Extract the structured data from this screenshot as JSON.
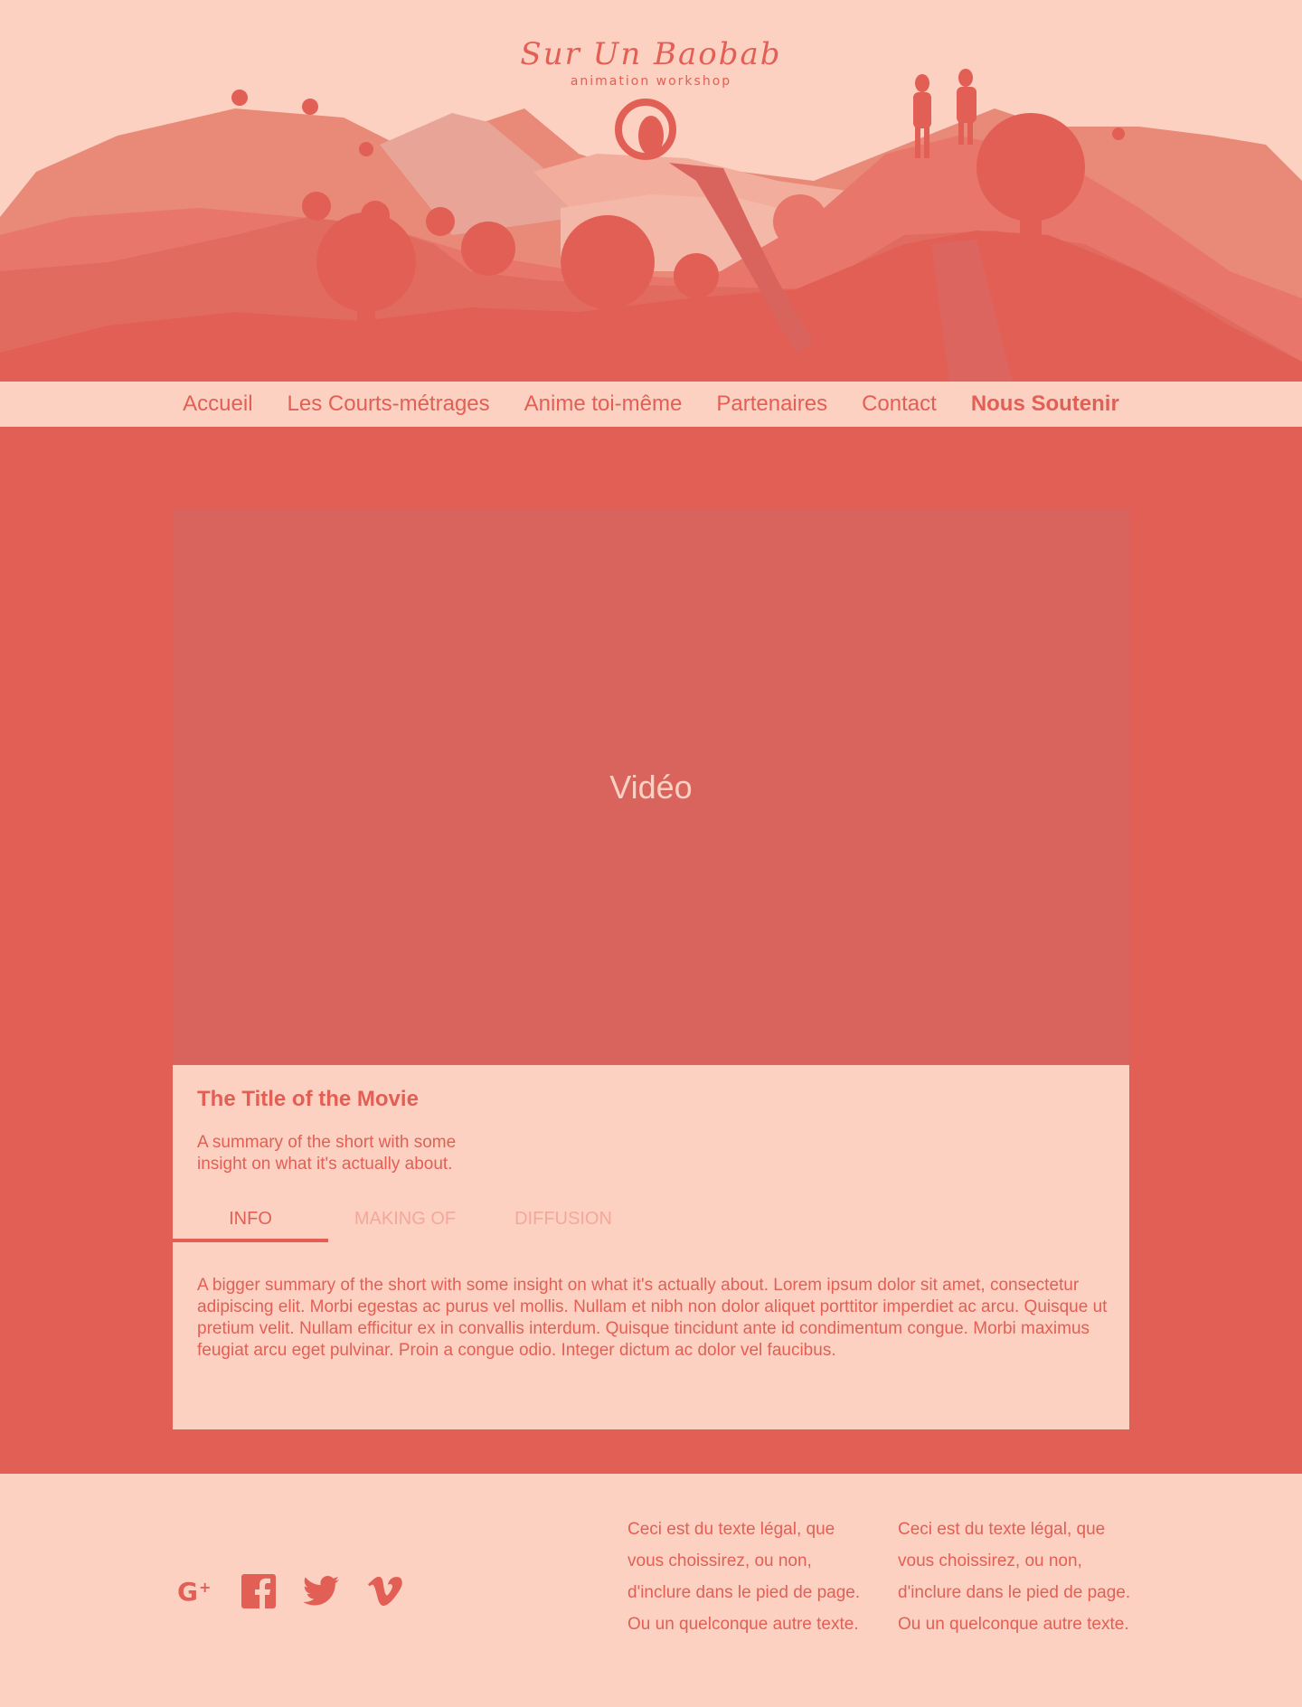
{
  "brand": {
    "title": "Sur Un Baobab",
    "subtitle": "animation workshop"
  },
  "nav": {
    "items": [
      "Accueil",
      "Les Courts-métrages",
      "Anime toi-même",
      "Partenaires",
      "Contact"
    ],
    "cta": "Nous Soutenir"
  },
  "video": {
    "label": "Vidéo"
  },
  "movie": {
    "title": "The Title of the Movie",
    "summary": "A summary of the short with some insight on what it's actually about.",
    "tabs": [
      "INFO",
      "MAKING OF",
      "DIFFUSION"
    ],
    "active_tab": "INFO",
    "long_summary": "A bigger summary of the short with some insight on what it's actually about. Lorem ipsum dolor sit amet, consectetur adipiscing elit. Morbi egestas ac purus vel mollis. Nullam et nibh non dolor aliquet porttitor imperdiet ac arcu. Quisque ut pretium velit. Nullam efficitur ex in convallis interdum. Quisque tincidunt ante id condimentum congue. Morbi maximus feugiat arcu eget pulvinar. Proin a congue odio. Integer dictum ac dolor vel faucibus."
  },
  "footer": {
    "social_icons": [
      "google-plus-icon",
      "facebook-icon",
      "twitter-icon",
      "vimeo-icon"
    ],
    "legal_1": "Ceci est du texte légal, que vous choissirez, ou non, d'inclure dans le pied de page. Ou un quelconque autre texte.",
    "legal_2": "Ceci est du texte légal, que vous choissirez, ou non, d'inclure dans le pied de page. Ou un quelconque autre texte."
  },
  "colors": {
    "accent": "#e25f55",
    "light": "#fcd1c2",
    "video_bg": "#d9645e",
    "inactive_tab": "#f3a89b"
  }
}
